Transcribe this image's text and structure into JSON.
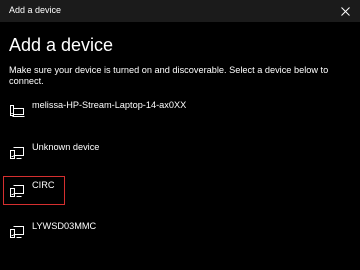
{
  "window": {
    "title": "Add a device",
    "close_icon": "close-icon"
  },
  "header": {
    "heading": "Add a device",
    "description": "Make sure your device is turned on and discoverable. Select a device below to connect."
  },
  "devices": [
    {
      "name": "melissa-HP-Stream-Laptop-14-ax0XX",
      "icon": "laptop-icon"
    },
    {
      "name": "Unknown device",
      "icon": "display-icon"
    },
    {
      "name": "CIRC",
      "icon": "display-icon"
    },
    {
      "name": "LYWSD03MMC",
      "icon": "display-icon"
    }
  ],
  "colors": {
    "background": "#000000",
    "titlebar": "#1b1b1b",
    "text": "#ffffff",
    "highlight_box": "#d52f2f"
  }
}
